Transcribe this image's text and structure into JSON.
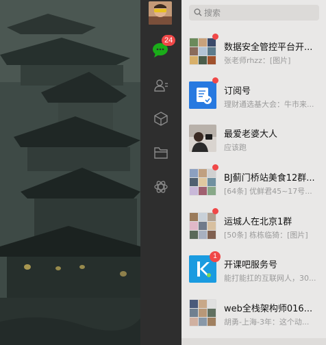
{
  "wallpaper": {
    "name": "desktop-wallpaper"
  },
  "sidebar": {
    "chat_badge": "24",
    "icons": [
      "chat-icon",
      "contacts-icon",
      "favorites-icon",
      "files-icon",
      "mini-programs-icon"
    ]
  },
  "search": {
    "placeholder": "搜索"
  },
  "chats": [
    {
      "name": "数据安全管控平台开...",
      "preview": "张老师rhzz：[图片]",
      "badge": "dot",
      "avatar": "group"
    },
    {
      "name": "订阅号",
      "preview": "理财通选基大会：牛市来...",
      "badge": "dot",
      "avatar": "subscription"
    },
    {
      "name": "最爱老婆大人",
      "preview": "应该跑",
      "badge": "",
      "avatar": "photo"
    },
    {
      "name": "BJ蓟门桥站美食12群...",
      "preview": "[64条] 优鲜君45~17号...",
      "badge": "dot",
      "avatar": "group"
    },
    {
      "name": "运城人在北京1群",
      "preview": "[50条] 栋栋临猗：[图片]",
      "badge": "dot",
      "avatar": "group"
    },
    {
      "name": "开课吧服务号",
      "preview": "能打能扛的互联网人，30...",
      "badge": "1",
      "avatar": "kaikeba"
    },
    {
      "name": "web全栈架构师016...",
      "preview": "胡勇-上海-3年：这个动...",
      "badge": "",
      "avatar": "group"
    }
  ],
  "colors": {
    "badge": "#f04848",
    "nav_bg": "#2e2e2e",
    "panel_bg": "#e9e8e7",
    "chat_green": "#1aad19"
  }
}
